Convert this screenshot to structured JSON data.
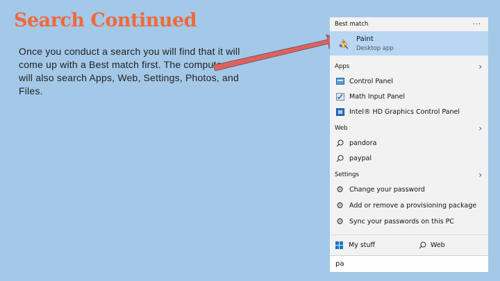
{
  "slide": {
    "title": "Search Continued",
    "body": "Once you conduct a search you will find that it will come up with a Best match first. The computer will also search Apps, Web, Settings, Photos, and Files."
  },
  "panel": {
    "best_match_header": "Best match",
    "more_label": "···",
    "best_match": {
      "title": "Paint",
      "subtitle": "Desktop app"
    },
    "apps": {
      "header": "Apps",
      "items": [
        {
          "label": "Control Panel",
          "icon": "control-panel-icon"
        },
        {
          "label": "Math Input Panel",
          "icon": "math-input-panel-icon"
        },
        {
          "label": "Intel® HD Graphics Control Panel",
          "icon": "intel-graphics-icon"
        }
      ]
    },
    "web": {
      "header": "Web",
      "items": [
        {
          "label": "pandora",
          "icon": "search-icon"
        },
        {
          "label": "paypal",
          "icon": "search-icon"
        }
      ]
    },
    "settings": {
      "header": "Settings",
      "items": [
        {
          "label": "Change your password",
          "icon": "gear-icon"
        },
        {
          "label": "Add or remove a provisioning package",
          "icon": "gear-icon"
        },
        {
          "label": "Sync your passwords on this PC",
          "icon": "gear-icon"
        }
      ]
    },
    "bottom": {
      "my_stuff": "My stuff",
      "web": "Web"
    },
    "search_value": "pa"
  },
  "colors": {
    "background": "#a4c8e8",
    "title": "#ee6a3c",
    "arrow": "#e06060",
    "best_match_highlight": "#b9d6f3"
  }
}
